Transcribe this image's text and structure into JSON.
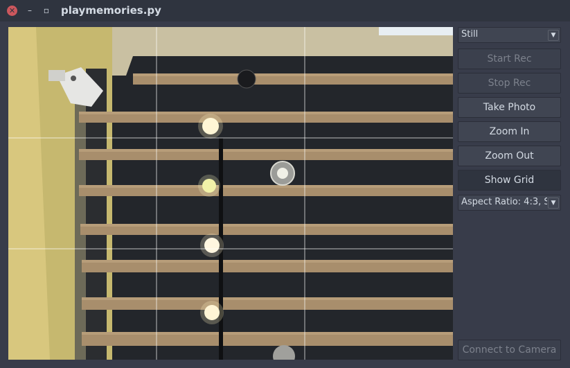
{
  "window": {
    "title": "playmemories.py"
  },
  "controls": {
    "mode_select": {
      "value": "Still"
    },
    "start_rec": "Start Rec",
    "stop_rec": "Stop Rec",
    "take_photo": "Take Photo",
    "zoom_in": "Zoom In",
    "zoom_out": "Zoom Out",
    "show_grid": "Show Grid",
    "aspect_select": {
      "value": "Aspect Ratio: 4:3, S"
    },
    "connect": "Connect to Camera"
  },
  "icons": {
    "close": "close-icon",
    "minimize": "minimize-icon",
    "maximize": "maximize-icon",
    "dropdown": "chevron-down-icon"
  },
  "colors": {
    "window_bg": "#383c4a",
    "titlebar_bg": "#2f343f",
    "close_button": "#cc575d",
    "button_bg": "#404552",
    "disabled_text": "#7c818c",
    "text": "#d3dae3"
  }
}
